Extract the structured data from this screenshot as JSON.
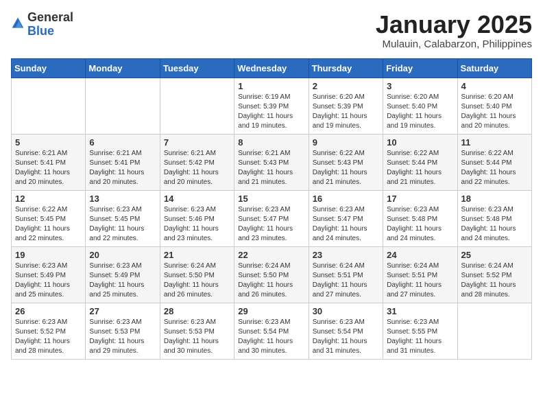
{
  "header": {
    "logo": {
      "general": "General",
      "blue": "Blue"
    },
    "title": "January 2025",
    "subtitle": "Mulauin, Calabarzon, Philippines"
  },
  "weekdays": [
    "Sunday",
    "Monday",
    "Tuesday",
    "Wednesday",
    "Thursday",
    "Friday",
    "Saturday"
  ],
  "weeks": [
    [
      {
        "day": "",
        "info": ""
      },
      {
        "day": "",
        "info": ""
      },
      {
        "day": "",
        "info": ""
      },
      {
        "day": "1",
        "info": "Sunrise: 6:19 AM\nSunset: 5:39 PM\nDaylight: 11 hours\nand 19 minutes."
      },
      {
        "day": "2",
        "info": "Sunrise: 6:20 AM\nSunset: 5:39 PM\nDaylight: 11 hours\nand 19 minutes."
      },
      {
        "day": "3",
        "info": "Sunrise: 6:20 AM\nSunset: 5:40 PM\nDaylight: 11 hours\nand 19 minutes."
      },
      {
        "day": "4",
        "info": "Sunrise: 6:20 AM\nSunset: 5:40 PM\nDaylight: 11 hours\nand 20 minutes."
      }
    ],
    [
      {
        "day": "5",
        "info": "Sunrise: 6:21 AM\nSunset: 5:41 PM\nDaylight: 11 hours\nand 20 minutes."
      },
      {
        "day": "6",
        "info": "Sunrise: 6:21 AM\nSunset: 5:41 PM\nDaylight: 11 hours\nand 20 minutes."
      },
      {
        "day": "7",
        "info": "Sunrise: 6:21 AM\nSunset: 5:42 PM\nDaylight: 11 hours\nand 20 minutes."
      },
      {
        "day": "8",
        "info": "Sunrise: 6:21 AM\nSunset: 5:43 PM\nDaylight: 11 hours\nand 21 minutes."
      },
      {
        "day": "9",
        "info": "Sunrise: 6:22 AM\nSunset: 5:43 PM\nDaylight: 11 hours\nand 21 minutes."
      },
      {
        "day": "10",
        "info": "Sunrise: 6:22 AM\nSunset: 5:44 PM\nDaylight: 11 hours\nand 21 minutes."
      },
      {
        "day": "11",
        "info": "Sunrise: 6:22 AM\nSunset: 5:44 PM\nDaylight: 11 hours\nand 22 minutes."
      }
    ],
    [
      {
        "day": "12",
        "info": "Sunrise: 6:22 AM\nSunset: 5:45 PM\nDaylight: 11 hours\nand 22 minutes."
      },
      {
        "day": "13",
        "info": "Sunrise: 6:23 AM\nSunset: 5:45 PM\nDaylight: 11 hours\nand 22 minutes."
      },
      {
        "day": "14",
        "info": "Sunrise: 6:23 AM\nSunset: 5:46 PM\nDaylight: 11 hours\nand 23 minutes."
      },
      {
        "day": "15",
        "info": "Sunrise: 6:23 AM\nSunset: 5:47 PM\nDaylight: 11 hours\nand 23 minutes."
      },
      {
        "day": "16",
        "info": "Sunrise: 6:23 AM\nSunset: 5:47 PM\nDaylight: 11 hours\nand 24 minutes."
      },
      {
        "day": "17",
        "info": "Sunrise: 6:23 AM\nSunset: 5:48 PM\nDaylight: 11 hours\nand 24 minutes."
      },
      {
        "day": "18",
        "info": "Sunrise: 6:23 AM\nSunset: 5:48 PM\nDaylight: 11 hours\nand 24 minutes."
      }
    ],
    [
      {
        "day": "19",
        "info": "Sunrise: 6:23 AM\nSunset: 5:49 PM\nDaylight: 11 hours\nand 25 minutes."
      },
      {
        "day": "20",
        "info": "Sunrise: 6:23 AM\nSunset: 5:49 PM\nDaylight: 11 hours\nand 25 minutes."
      },
      {
        "day": "21",
        "info": "Sunrise: 6:24 AM\nSunset: 5:50 PM\nDaylight: 11 hours\nand 26 minutes."
      },
      {
        "day": "22",
        "info": "Sunrise: 6:24 AM\nSunset: 5:50 PM\nDaylight: 11 hours\nand 26 minutes."
      },
      {
        "day": "23",
        "info": "Sunrise: 6:24 AM\nSunset: 5:51 PM\nDaylight: 11 hours\nand 27 minutes."
      },
      {
        "day": "24",
        "info": "Sunrise: 6:24 AM\nSunset: 5:51 PM\nDaylight: 11 hours\nand 27 minutes."
      },
      {
        "day": "25",
        "info": "Sunrise: 6:24 AM\nSunset: 5:52 PM\nDaylight: 11 hours\nand 28 minutes."
      }
    ],
    [
      {
        "day": "26",
        "info": "Sunrise: 6:23 AM\nSunset: 5:52 PM\nDaylight: 11 hours\nand 28 minutes."
      },
      {
        "day": "27",
        "info": "Sunrise: 6:23 AM\nSunset: 5:53 PM\nDaylight: 11 hours\nand 29 minutes."
      },
      {
        "day": "28",
        "info": "Sunrise: 6:23 AM\nSunset: 5:53 PM\nDaylight: 11 hours\nand 30 minutes."
      },
      {
        "day": "29",
        "info": "Sunrise: 6:23 AM\nSunset: 5:54 PM\nDaylight: 11 hours\nand 30 minutes."
      },
      {
        "day": "30",
        "info": "Sunrise: 6:23 AM\nSunset: 5:54 PM\nDaylight: 11 hours\nand 31 minutes."
      },
      {
        "day": "31",
        "info": "Sunrise: 6:23 AM\nSunset: 5:55 PM\nDaylight: 11 hours\nand 31 minutes."
      },
      {
        "day": "",
        "info": ""
      }
    ]
  ]
}
